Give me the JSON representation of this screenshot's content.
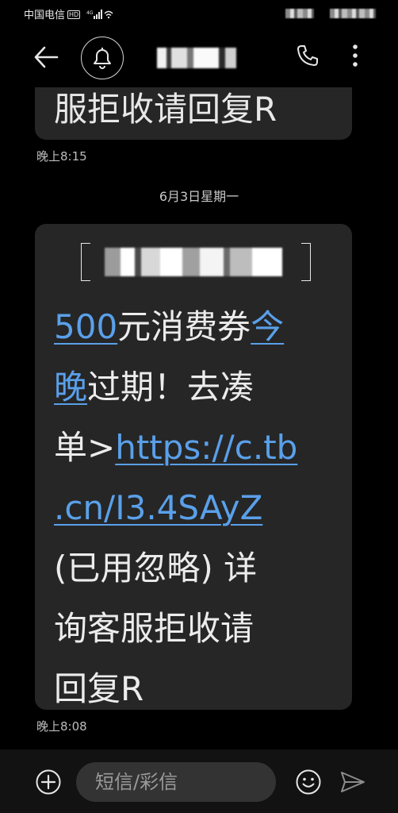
{
  "status_bar": {
    "carrier": "中国电信",
    "hd_badge": "HD",
    "network": "4G"
  },
  "header": {
    "back_icon": "arrow-left-icon",
    "avatar_icon": "bell-icon",
    "call_icon": "phone-icon",
    "more_icon": "more-vertical-icon"
  },
  "messages": {
    "previous": {
      "text": "服拒收请回复R",
      "time": "晚上8:15"
    },
    "date_divider": "6月3日星期一",
    "current": {
      "line1_link": "500",
      "line1_text": "元消费券",
      "line1_link2": "今",
      "line2_link": "晚",
      "line2_text": "过期！去凑",
      "line3_text": "单>",
      "line3_link": "https://c.tb",
      "line4_link": ".cn/I3.4SAyZ",
      "line5_text": "(已用忽略) 详",
      "line6_text": "询客服拒收请",
      "line7_text": "回复R",
      "time": "晚上8:08"
    }
  },
  "input_bar": {
    "placeholder": "短信/彩信",
    "add_icon": "plus-circle-icon",
    "emoji_icon": "smiley-icon",
    "send_icon": "send-icon"
  },
  "colors": {
    "background": "#000000",
    "bubble": "#262626",
    "link": "#5aa0ea",
    "input_bar": "#121212",
    "input_field": "#333333"
  }
}
